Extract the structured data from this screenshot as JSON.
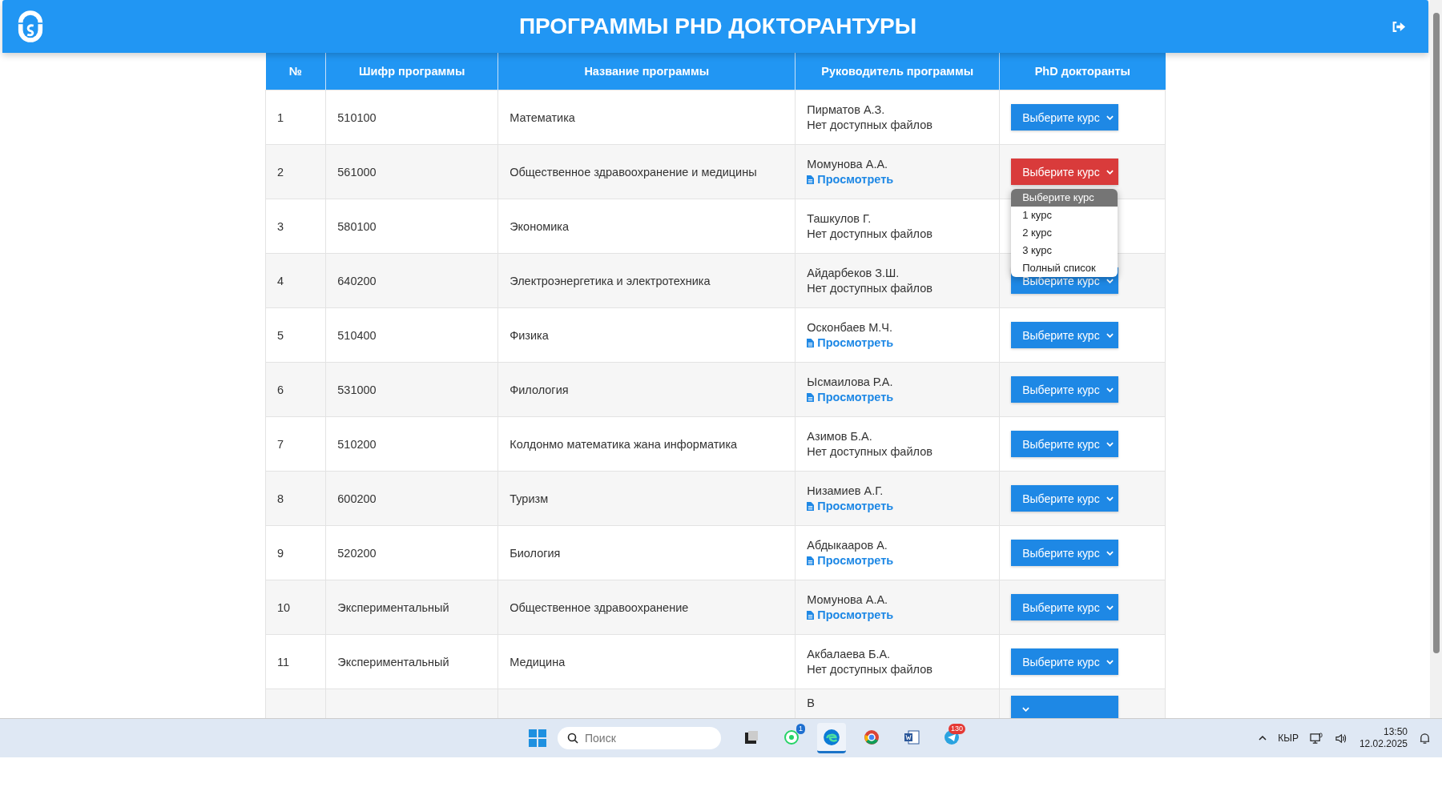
{
  "header": {
    "title": "ПРОГРАММЫ PHD ДОКТОРАНТУРЫ"
  },
  "table": {
    "columns": [
      "№",
      "Шифр программы",
      "Название программы",
      "Руководитель программы",
      "PhD докторанты"
    ],
    "rows": [
      {
        "number": "1",
        "code": "510100",
        "name": "Математика",
        "leader": "Пирматов А.З.",
        "files": {
          "kind": "none",
          "text": "Нет доступных файлов"
        },
        "course_select": {
          "label": "Выберите курс",
          "open": false
        }
      },
      {
        "number": "2",
        "code": "561000",
        "name": "Общественное здравоохранение и медицины",
        "leader": "Момунова А.А.",
        "files": {
          "kind": "link",
          "text": "Просмотреть"
        },
        "course_select": {
          "label": "Выберите курс",
          "open": true,
          "options": [
            {
              "label": "Выберите курс",
              "selected": true
            },
            {
              "label": "1 курс",
              "selected": false
            },
            {
              "label": "2 курс",
              "selected": false
            },
            {
              "label": "3 курс",
              "selected": false
            },
            {
              "label": "Полный список",
              "selected": false
            }
          ]
        }
      },
      {
        "number": "3",
        "code": "580100",
        "name": "Экономика",
        "leader": "Ташкулов Г.",
        "files": {
          "kind": "none",
          "text": "Нет доступных файлов"
        }
      },
      {
        "number": "4",
        "code": "640200",
        "name": "Электроэнергетика и электротехника",
        "leader": "Айдарбеков З.Ш.",
        "files": {
          "kind": "none",
          "text": "Нет доступных файлов"
        },
        "course_select": {
          "label": "Выберите курс",
          "open": false
        }
      },
      {
        "number": "5",
        "code": "510400",
        "name": "Физика",
        "leader": "Осконбаев М.Ч.",
        "files": {
          "kind": "link",
          "text": "Просмотреть"
        },
        "course_select": {
          "label": "Выберите курс",
          "open": false
        }
      },
      {
        "number": "6",
        "code": "531000",
        "name": "Филология",
        "leader": "Ысмаилова Р.А.",
        "files": {
          "kind": "link",
          "text": "Просмотреть"
        },
        "course_select": {
          "label": "Выберите курс",
          "open": false
        }
      },
      {
        "number": "7",
        "code": "510200",
        "name": "Колдонмо математика жана информатика",
        "leader": "Азимов Б.А.",
        "files": {
          "kind": "none",
          "text": "Нет доступных файлов"
        },
        "course_select": {
          "label": "Выберите курс",
          "open": false
        }
      },
      {
        "number": "8",
        "code": "600200",
        "name": "Туризм",
        "leader": "Низамиев А.Г.",
        "files": {
          "kind": "link",
          "text": "Просмотреть"
        },
        "course_select": {
          "label": "Выберите курс",
          "open": false
        }
      },
      {
        "number": "9",
        "code": "520200",
        "name": "Биология",
        "leader": "Абдыкааров А.",
        "files": {
          "kind": "link",
          "text": "Просмотреть"
        },
        "course_select": {
          "label": "Выберите курс",
          "open": false
        }
      },
      {
        "number": "10",
        "code": "Экспериментальный",
        "name": "Общественное здравоохранение",
        "leader": "Момунова А.А.",
        "files": {
          "kind": "link",
          "text": "Просмотреть"
        },
        "course_select": {
          "label": "Выберите курс",
          "open": false
        }
      },
      {
        "number": "11",
        "code": "Экспериментальный",
        "name": "Медицина",
        "leader": "Акбалаева Б.А.",
        "files": {
          "kind": "none",
          "text": "Нет доступных файлов"
        },
        "course_select": {
          "label": "Выберите курс",
          "open": false
        }
      },
      {
        "leader": "В",
        "course_select": {
          "open": false
        }
      }
    ]
  },
  "taskbar": {
    "search": {
      "placeholder": "Поиск"
    },
    "apps": [
      {
        "kind": "taskview",
        "active": false
      },
      {
        "kind": "whatsapp",
        "active": false,
        "badge": "1"
      },
      {
        "kind": "edge",
        "active": true
      },
      {
        "kind": "chrome",
        "active": false
      },
      {
        "kind": "word",
        "active": false
      },
      {
        "kind": "telegram",
        "active": false,
        "badge": "130"
      }
    ],
    "language": "КЫР",
    "time": "13:50",
    "date": "12.02.2025"
  }
}
